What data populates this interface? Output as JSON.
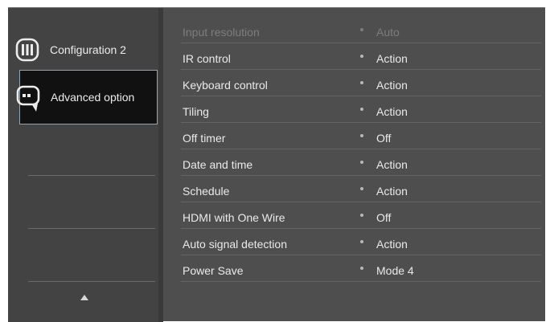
{
  "sidebar": {
    "items": [
      {
        "label": "Configuration 2",
        "icon": "configuration-icon",
        "selected": false
      },
      {
        "label": "Advanced option",
        "icon": "advanced-option-icon",
        "selected": true
      }
    ],
    "scroll_icon": "up-arrow-icon"
  },
  "settings": [
    {
      "name": "Input resolution",
      "value": "Auto",
      "enabled": false
    },
    {
      "name": "IR control",
      "value": "Action",
      "enabled": true
    },
    {
      "name": "Keyboard control",
      "value": "Action",
      "enabled": true
    },
    {
      "name": "Tiling",
      "value": "Action",
      "enabled": true
    },
    {
      "name": "Off timer",
      "value": "Off",
      "enabled": true
    },
    {
      "name": "Date and time",
      "value": "Action",
      "enabled": true
    },
    {
      "name": "Schedule",
      "value": "Action",
      "enabled": true
    },
    {
      "name": "HDMI with One Wire",
      "value": "Off",
      "enabled": true
    },
    {
      "name": "Auto signal detection",
      "value": "Action",
      "enabled": true
    },
    {
      "name": "Power Save",
      "value": "Mode 4",
      "enabled": true
    }
  ],
  "colors": {
    "panel": "#4e4e4e",
    "sidebar": "#434343",
    "selected_background": "#111111",
    "selected_border": "#9aa2a8",
    "text": "#eaeaea",
    "disabled_text": "#7d7d7d"
  }
}
